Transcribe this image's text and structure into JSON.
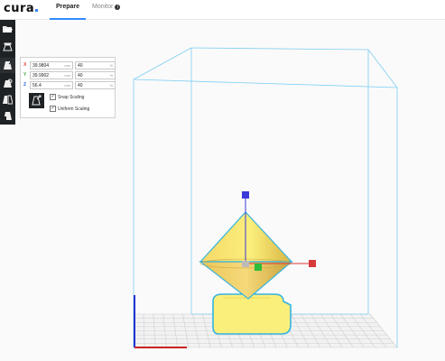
{
  "app": {
    "logo_text": "cura",
    "logo_dot_color": "#3282ff"
  },
  "tabs": [
    {
      "label": "Prepare",
      "active": true
    },
    {
      "label": "Monitor",
      "active": false,
      "info_icon": "info-icon"
    }
  ],
  "toolbar": {
    "tools": [
      {
        "name": "open-file-icon",
        "active": false
      },
      {
        "name": "move-tool-icon",
        "active": false
      },
      {
        "name": "scale-tool-icon",
        "active": true
      },
      {
        "name": "rotate-tool-icon",
        "active": false
      },
      {
        "name": "mirror-tool-icon",
        "active": false
      },
      {
        "name": "per-model-settings-icon",
        "active": false
      }
    ]
  },
  "scale_panel": {
    "rows": [
      {
        "axis": "X",
        "axis_color": "#e0403a",
        "size": "39.9804",
        "size_unit": "mm",
        "percent": "40",
        "percent_unit": "%"
      },
      {
        "axis": "Y",
        "axis_color": "#3aa845",
        "size": "39.9902",
        "size_unit": "mm",
        "percent": "40",
        "percent_unit": "%"
      },
      {
        "axis": "Z",
        "axis_color": "#3068d8",
        "size": "56.4",
        "size_unit": "mm",
        "percent": "40",
        "percent_unit": "%"
      }
    ],
    "lock_icon": "uniform-scale-icon",
    "snap_scaling": {
      "label": "Snap Scaling",
      "checked": true
    },
    "uniform_scaling": {
      "label": "Uniform Scaling",
      "checked": true
    }
  },
  "colors": {
    "build_volume_outline": "#7ecff3",
    "model_fill": "#fbef7c",
    "model_outline": "#35b3df",
    "handle_x": "#d83a3a",
    "handle_y": "#2ebd3a",
    "handle_z": "#3a3ad8",
    "grid": "#cccccc"
  }
}
